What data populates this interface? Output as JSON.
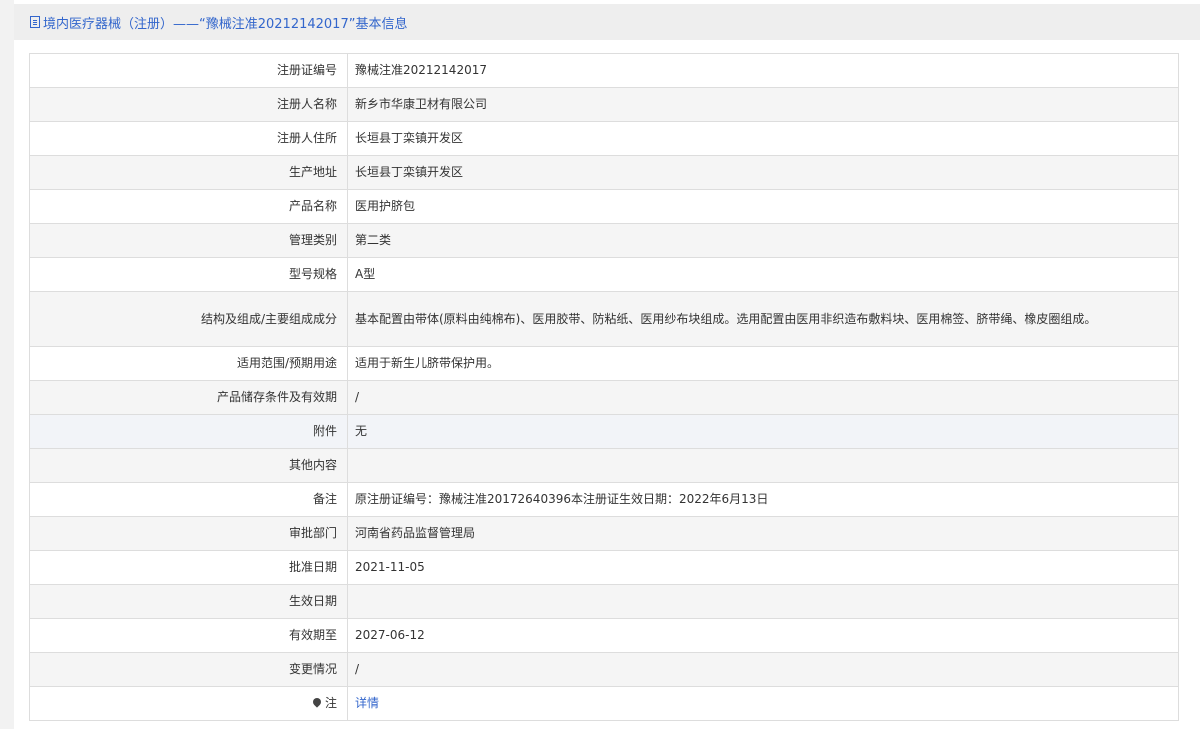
{
  "header": {
    "title": "境内医疗器械（注册）——“豫械注准20212142017”基本信息",
    "icon": "document-icon",
    "color": "#3366cc"
  },
  "rows": [
    {
      "label": "注册证编号",
      "value": "豫械注准20212142017"
    },
    {
      "label": "注册人名称",
      "value": "新乡市华康卫材有限公司"
    },
    {
      "label": "注册人住所",
      "value": "长垣县丁栾镇开发区"
    },
    {
      "label": "生产地址",
      "value": "长垣县丁栾镇开发区"
    },
    {
      "label": "产品名称",
      "value": "医用护脐包"
    },
    {
      "label": "管理类别",
      "value": "第二类"
    },
    {
      "label": "型号规格",
      "value": "A型"
    },
    {
      "label": "结构及组成/主要组成成分",
      "value": "基本配置由带体(原料由纯棉布)、医用胶带、防粘纸、医用纱布块组成。选用配置由医用非织造布敷料块、医用棉签、脐带绳、橡皮圈组成。"
    },
    {
      "label": "适用范围/预期用途",
      "value": "适用于新生儿脐带保护用。"
    },
    {
      "label": "产品储存条件及有效期",
      "value": "/"
    },
    {
      "label": "附件",
      "value": "无"
    },
    {
      "label": "其他内容",
      "value": ""
    },
    {
      "label": "备注",
      "value": "原注册证编号：豫械注准20172640396本注册证生效日期：2022年6月13日"
    },
    {
      "label": "审批部门",
      "value": "河南省药品监督管理局"
    },
    {
      "label": "批准日期",
      "value": "2021-11-05"
    },
    {
      "label": "生效日期",
      "value": ""
    },
    {
      "label": "有效期至",
      "value": "2027-06-12"
    },
    {
      "label": "变更情况",
      "value": "/"
    }
  ],
  "note_row": {
    "label": "注",
    "icon": "pin-icon",
    "link_text": "详情"
  }
}
